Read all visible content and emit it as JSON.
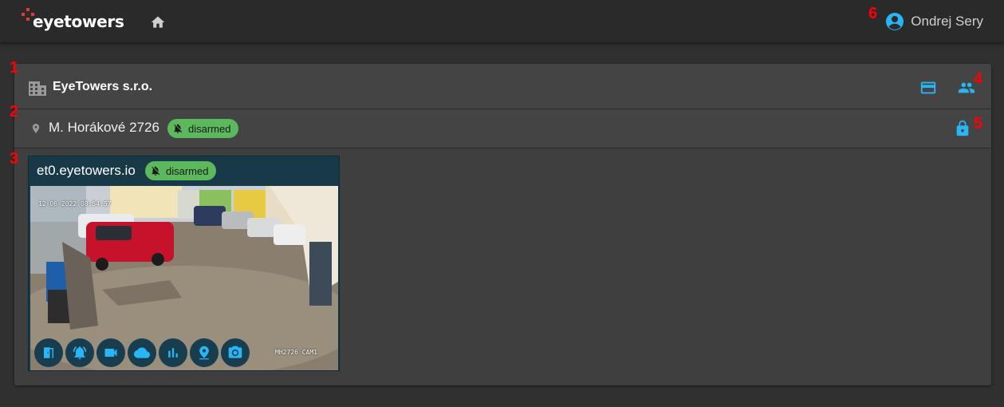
{
  "header": {
    "logo_text": "eyetowers",
    "user_name": "Ondrej Sery",
    "icons": {
      "home": "home-icon",
      "account": "account-circle-icon"
    }
  },
  "markers": [
    "1",
    "2",
    "3",
    "4",
    "5",
    "6"
  ],
  "organization": {
    "name": "EyeTowers s.r.o.",
    "icons": [
      "building-icon",
      "credit-card-icon",
      "people-icon"
    ]
  },
  "site": {
    "name": "M. Horákové 2726",
    "status": "disarmed",
    "icons": [
      "location-pin-icon",
      "bell-off-icon",
      "lock-icon"
    ]
  },
  "camera": {
    "name": "et0.eyetowers.io",
    "status": "disarmed",
    "timestamp": "12-06-2022 08:54:57",
    "overlay_label": "MH2726 CAM1",
    "tools": [
      "door-icon",
      "alarm-bell-icon",
      "video-camera-icon",
      "cloud-icon",
      "bar-chart-icon",
      "map-pin-icon",
      "photo-camera-icon"
    ]
  },
  "colors": {
    "accent": "#29b6f6",
    "badge_green": "#5cb85c",
    "marker_red": "#ff0000",
    "logo_red": "#e53935"
  }
}
